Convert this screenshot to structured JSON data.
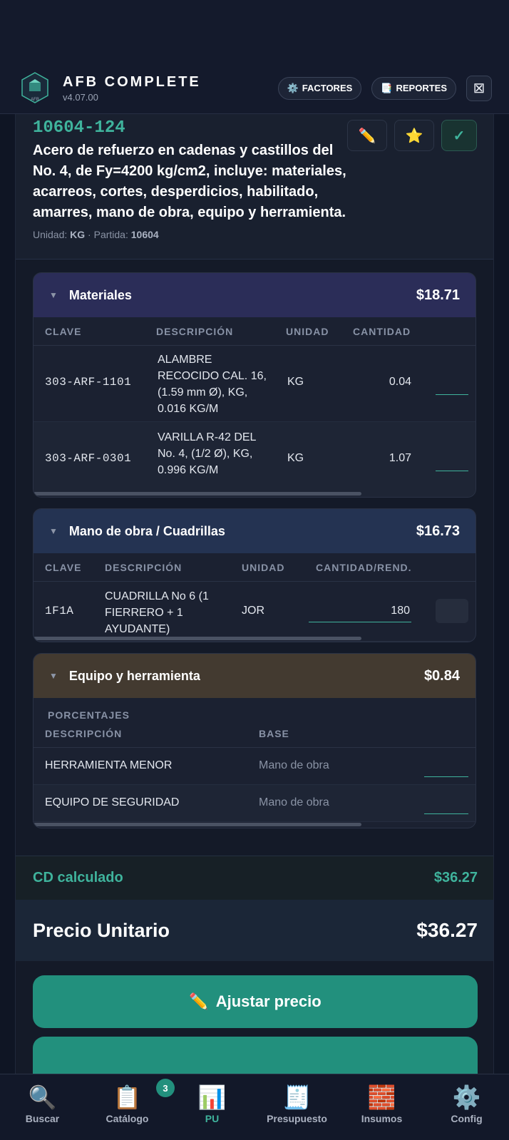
{
  "app": {
    "title": "AFB COMPLETE",
    "version": "v4.07.00",
    "logo_text": "AFB",
    "factores_label": "FACTORES",
    "reportes_label": "REPORTES"
  },
  "item": {
    "code": "10604-124",
    "description": "Acero de refuerzo en cadenas y castillos del No. 4, de Fy=4200 kg/cm2, incluye: materiales, acarreos, cortes, desperdicios, habilitado, amarres, mano de obra, equipo y herramienta.",
    "unit_label": "Unidad:",
    "unit": "KG",
    "separator": "·",
    "partida_label": "Partida:",
    "partida": "10604"
  },
  "materiales": {
    "title": "Materiales",
    "total": "$18.71",
    "columns": [
      "CLAVE",
      "DESCRIPCIÓN",
      "UNIDAD",
      "CANTIDAD"
    ],
    "rows": [
      {
        "clave": "303-ARF-1101",
        "descripcion": "ALAMBRE RECOCIDO CAL. 16, (1.59 mm Ø), KG, 0.016 KG/M",
        "unidad": "KG",
        "cantidad": "0.04"
      },
      {
        "clave": "303-ARF-0301",
        "descripcion": "VARILLA R-42 DEL No. 4, (1/2 Ø), KG, 0.996 KG/M",
        "unidad": "KG",
        "cantidad": "1.07"
      }
    ]
  },
  "mano_obra": {
    "title": "Mano de obra / Cuadrillas",
    "total": "$16.73",
    "columns": [
      "CLAVE",
      "DESCRIPCIÓN",
      "UNIDAD",
      "CANTIDAD/REND."
    ],
    "rows": [
      {
        "clave": "1F1A",
        "descripcion": "CUADRILLA No 6 (1 FIERRERO + 1 AYUDANTE)",
        "unidad": "JOR",
        "cantidad": "180"
      }
    ]
  },
  "equipo": {
    "title": "Equipo y herramienta",
    "total": "$0.84",
    "section_label": "PORCENTAJES",
    "columns": [
      "DESCRIPCIÓN",
      "BASE"
    ],
    "rows": [
      {
        "descripcion": "HERRAMIENTA MENOR",
        "base": "Mano de obra"
      },
      {
        "descripcion": "EQUIPO DE SEGURIDAD",
        "base": "Mano de obra"
      }
    ]
  },
  "summary": {
    "cd_label": "CD calculado",
    "cd_value": "$36.27",
    "pu_label": "Precio Unitario",
    "pu_value": "$36.27",
    "adjust_label": "Ajustar precio"
  },
  "nav": {
    "items": [
      {
        "label": "Buscar",
        "icon": "search-icon"
      },
      {
        "label": "Catálogo",
        "icon": "clipboard-icon",
        "badge": "3"
      },
      {
        "label": "PU",
        "icon": "bar-chart-icon"
      },
      {
        "label": "Presupuesto",
        "icon": "receipt-icon"
      },
      {
        "label": "Insumos",
        "icon": "bricks-icon"
      },
      {
        "label": "Config",
        "icon": "gear-icon"
      }
    ],
    "active": "PU"
  },
  "colors": {
    "accent": "#3fb39c",
    "button": "#22907d",
    "background": "#0f1524"
  }
}
